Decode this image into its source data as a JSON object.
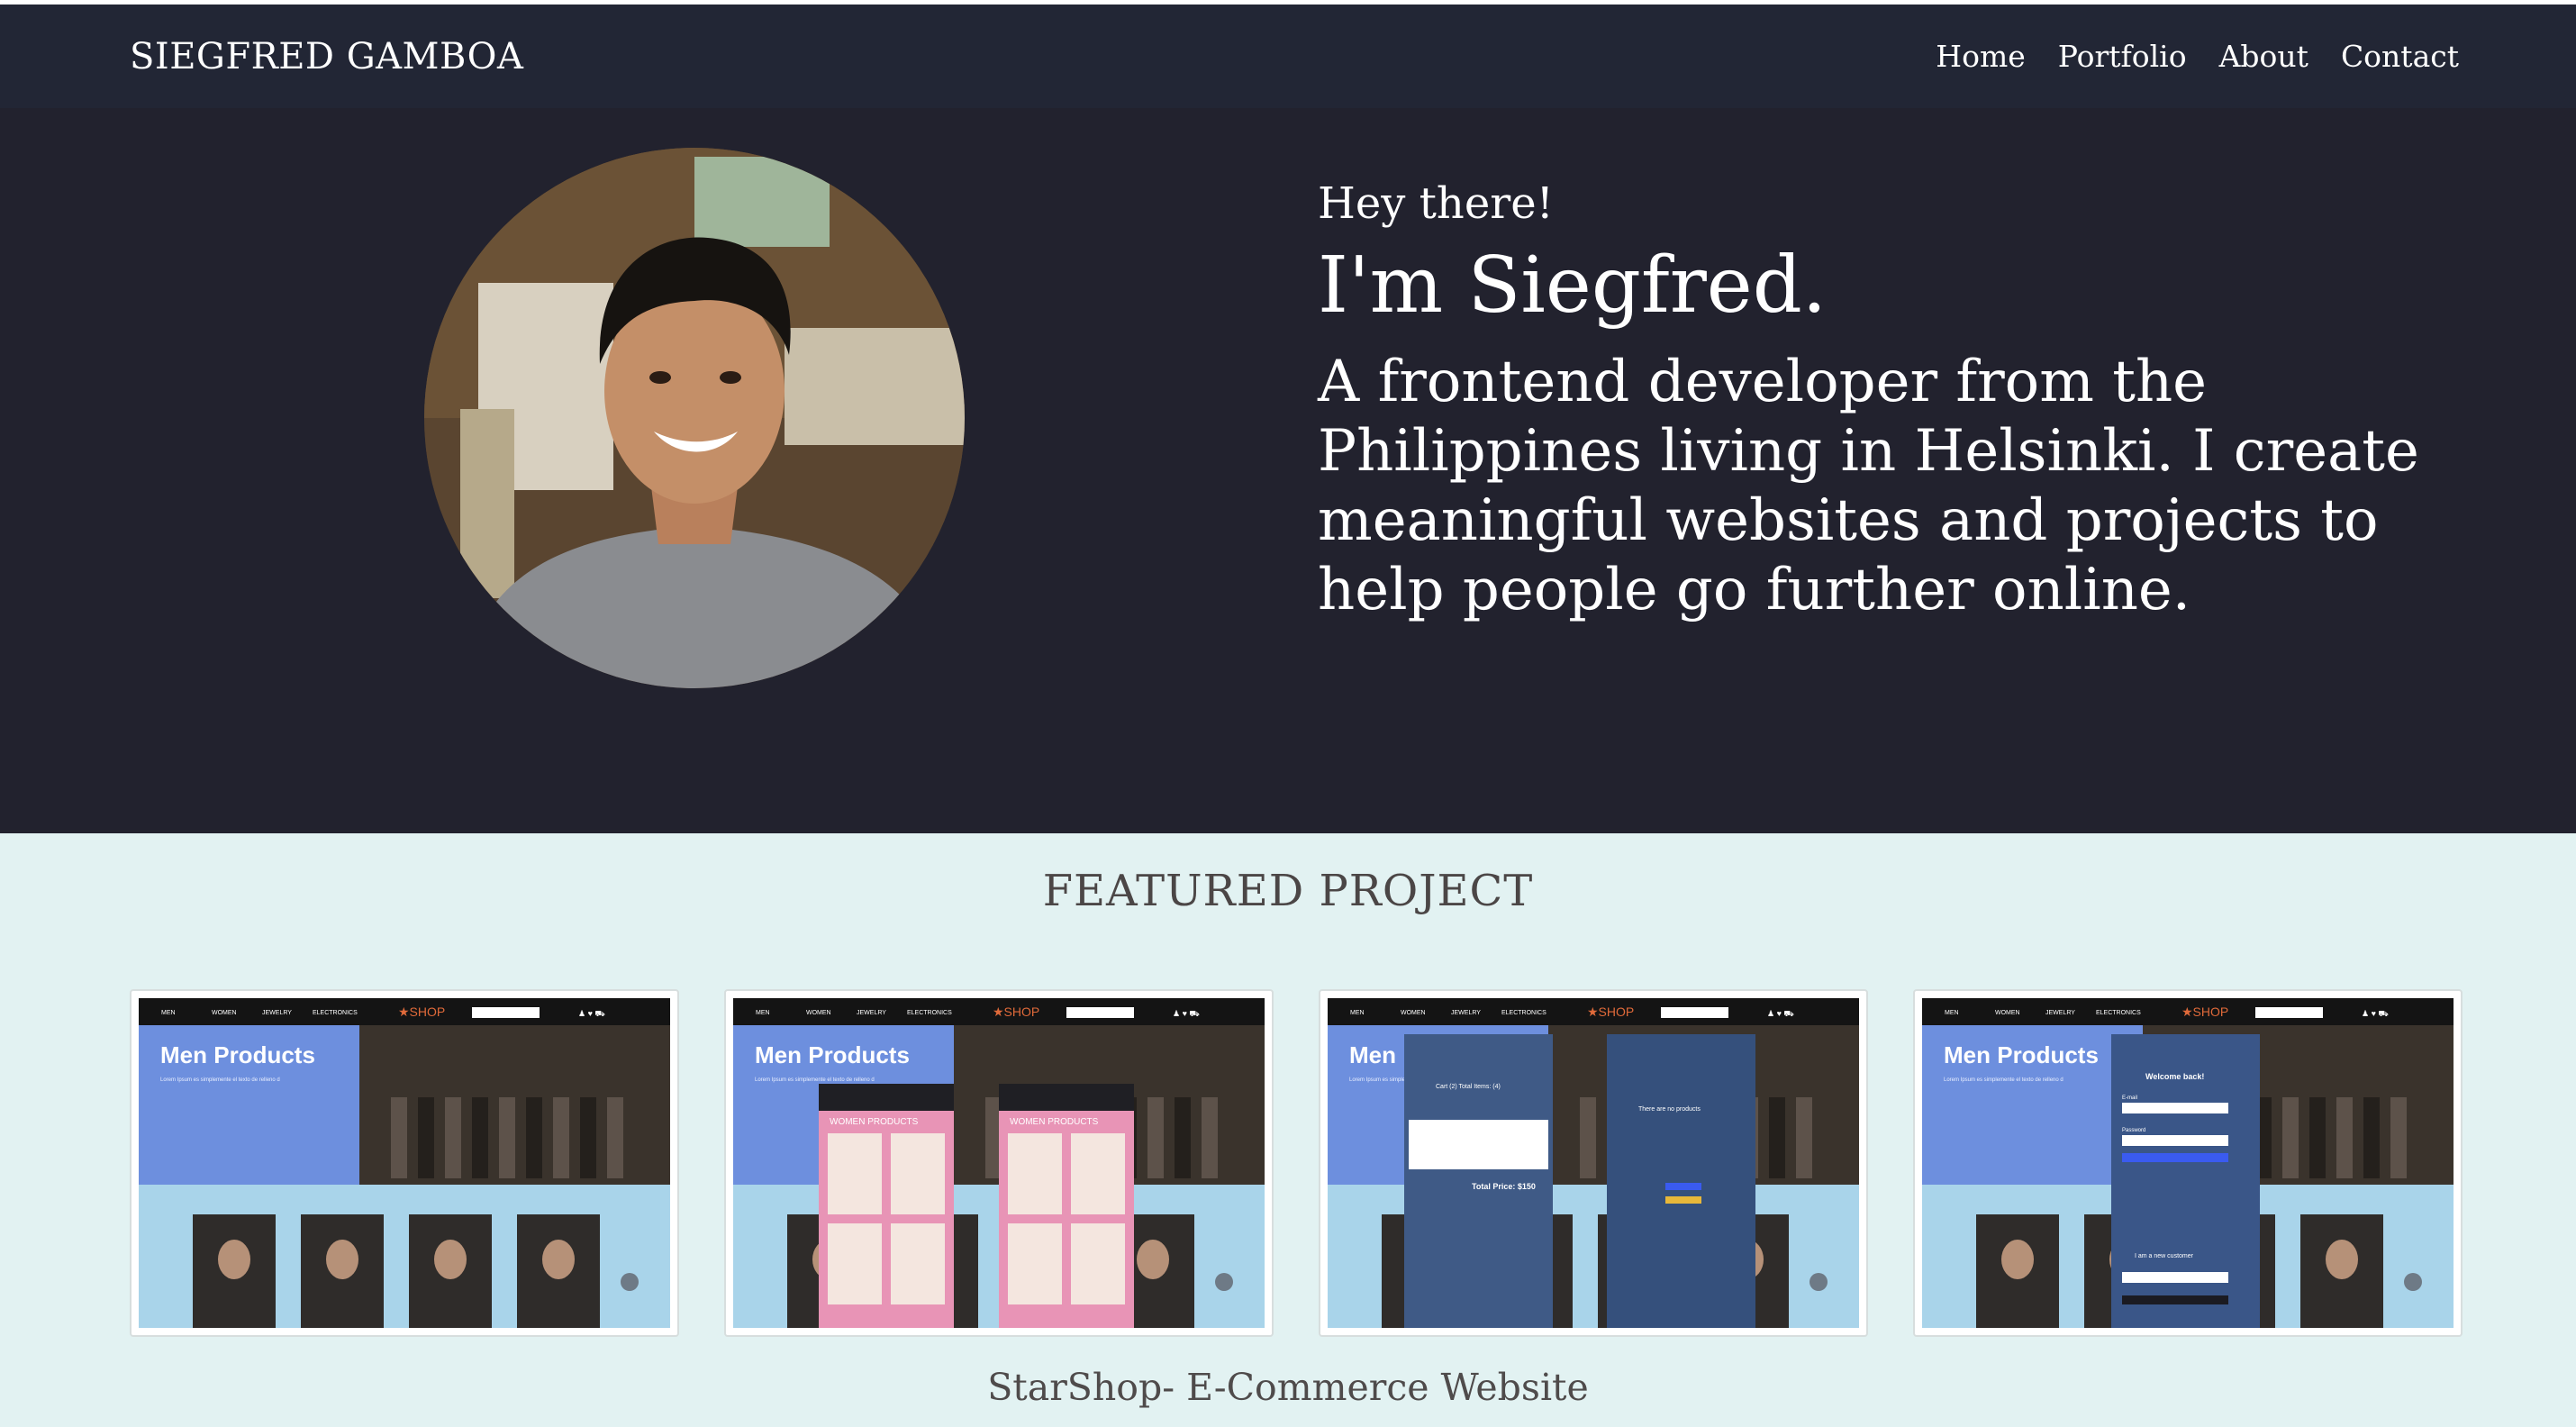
{
  "navbar": {
    "brand": "SIEGFRED GAMBOA",
    "links": [
      "Home",
      "Portfolio",
      "About",
      "Contact"
    ]
  },
  "hero": {
    "greeting": "Hey there!",
    "name": "I'm Siegfred.",
    "description": "A frontend developer from the Philippines living in Helsinki. I create meaningful websites and projects to help people go further online."
  },
  "featured": {
    "title": "FEATURED PROJECT",
    "caption": "StarShop- E-Commerce Website",
    "screens": [
      {
        "nav": [
          "MEN",
          "WOMEN",
          "JEWELRY",
          "ELECTRONICS"
        ],
        "logo": "SHOP",
        "banner_title": "Men Products",
        "banner_text": "Lorem Ipsum es simplemente el texto de relleno de las imprentas y archivos de texto.",
        "overlay": "none"
      },
      {
        "nav": [
          "MEN",
          "WOMEN",
          "JEWELRY",
          "ELECTRONICS"
        ],
        "logo": "SHOP",
        "banner_title": "Men Products",
        "banner_text": "Lorem Ipsum es simplemente el texto de relleno de las imprentas y archivos de texto.",
        "overlay": "women",
        "overlay_title": "WOMEN PRODUCTS"
      },
      {
        "nav": [
          "MEN",
          "WOMEN",
          "JEWELRY",
          "ELECTRONICS"
        ],
        "logo": "SHOP",
        "banner_title": "Men",
        "banner_text": "Lorem Ipsum es simplemente el texto de relleno.",
        "overlay": "cart",
        "cart_header": "Cart (2) Total Items: (4)",
        "cart_total": "Total Price: $150",
        "empty_text": "There are no products in your shopping cart."
      },
      {
        "nav": [
          "MEN",
          "WOMEN",
          "JEWELRY",
          "ELECTRONICS"
        ],
        "logo": "SHOP",
        "banner_title": "Men Products",
        "banner_text": "Lorem Ipsum es simplemente el texto de relleno de las imprentas y archivos de texto.",
        "overlay": "login",
        "login_title": "Welcome back!",
        "login_email": "E-mail",
        "login_password": "Password",
        "new_customer": "I am a new customer"
      }
    ]
  },
  "colors": {
    "navbar_bg": "#222635",
    "hero_bg": "#22222e",
    "featured_bg": "#e2f2f2",
    "shop_banner": "#6d8fde",
    "shop_products_bg": "#a9d4ea",
    "shop_accent": "#e06a3a"
  }
}
